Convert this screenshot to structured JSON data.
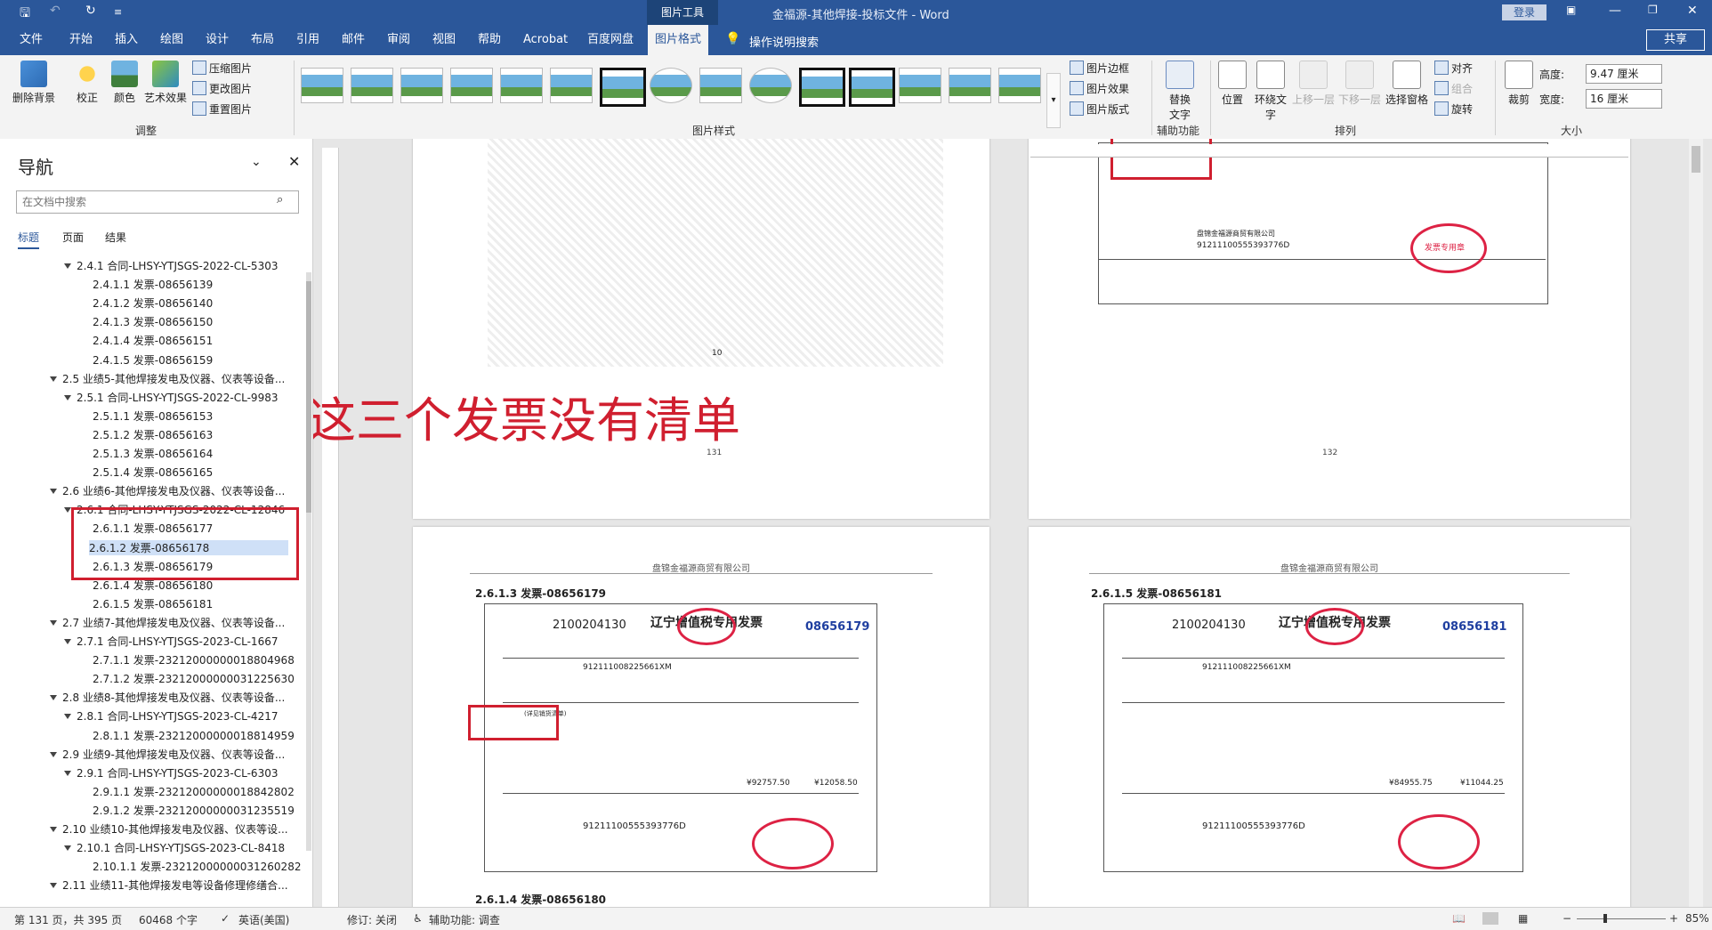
{
  "titlebar": {
    "title": "金福源-其他焊接-投标文件 - Word",
    "picture_tools": "图片工具",
    "login_button": "登录"
  },
  "menu": {
    "tabs": [
      "文件",
      "开始",
      "插入",
      "绘图",
      "设计",
      "布局",
      "引用",
      "邮件",
      "审阅",
      "视图",
      "帮助",
      "Acrobat",
      "百度网盘",
      "图片格式"
    ],
    "active_tab": "图片格式",
    "tell_me": "操作说明搜索",
    "share": "共享"
  },
  "ribbon": {
    "remove_bg": "删除背景",
    "corrections": "校正",
    "color": "颜色",
    "artistic": "艺术效果",
    "compress": "压缩图片",
    "change": "更改图片",
    "reset": "重置图片",
    "group_adjust": "调整",
    "group_styles": "图片样式",
    "border": "图片边框",
    "effects": "图片效果",
    "layout": "图片版式",
    "alt_text_1": "替换",
    "alt_text_2": "文字",
    "group_access": "辅助功能",
    "position": "位置",
    "wrap_1": "环绕文",
    "wrap_2": "字",
    "forward": "上移一层",
    "backward": "下移一层",
    "selection": "选择窗格",
    "align": "对齐",
    "group_obj": "组合",
    "rotate": "旋转",
    "group_arrange": "排列",
    "crop": "裁剪",
    "height_label": "高度:",
    "height_value": "9.47 厘米",
    "width_label": "宽度:",
    "width_value": "16 厘米",
    "group_size": "大小"
  },
  "nav": {
    "title": "导航",
    "search_placeholder": "在文档中搜索",
    "tabs": [
      "标题",
      "页面",
      "结果"
    ],
    "items": [
      {
        "level": 2,
        "text": "2.4.1 合同-LHSY-YTJSGS-2022-CL-5303",
        "arrow": true
      },
      {
        "level": 3,
        "text": "2.4.1.1 发票-08656139"
      },
      {
        "level": 3,
        "text": "2.4.1.2 发票-08656140"
      },
      {
        "level": 3,
        "text": "2.4.1.3 发票-08656150"
      },
      {
        "level": 3,
        "text": "2.4.1.4 发票-08656151"
      },
      {
        "level": 3,
        "text": "2.4.1.5 发票-08656159"
      },
      {
        "level": 1,
        "text": "2.5 业绩5-其他焊接发电及仪器、仪表等设备...",
        "arrow": true
      },
      {
        "level": 2,
        "text": "2.5.1 合同-LHSY-YTJSGS-2022-CL-9983",
        "arrow": true
      },
      {
        "level": 3,
        "text": "2.5.1.1 发票-08656153"
      },
      {
        "level": 3,
        "text": "2.5.1.2 发票-08656163"
      },
      {
        "level": 3,
        "text": "2.5.1.3 发票-08656164"
      },
      {
        "level": 3,
        "text": "2.5.1.4 发票-08656165"
      },
      {
        "level": 1,
        "text": "2.6 业绩6-其他焊接发电及仪器、仪表等设备...",
        "arrow": true
      },
      {
        "level": 2,
        "text": "2.6.1 合同-LHSY-YTJSGS-2022-CL-12846",
        "arrow": true
      },
      {
        "level": 3,
        "text": "2.6.1.1 发票-08656177"
      },
      {
        "level": 3,
        "text": "2.6.1.2 发票-08656178",
        "selected": true
      },
      {
        "level": 3,
        "text": "2.6.1.3 发票-08656179"
      },
      {
        "level": 3,
        "text": "2.6.1.4 发票-08656180"
      },
      {
        "level": 3,
        "text": "2.6.1.5 发票-08656181"
      },
      {
        "level": 1,
        "text": "2.7 业绩7-其他焊接发电及仪器、仪表等设备...",
        "arrow": true
      },
      {
        "level": 2,
        "text": "2.7.1 合同-LHSY-YTJSGS-2023-CL-1667",
        "arrow": true
      },
      {
        "level": 3,
        "text": "2.7.1.1 发票-23212000000018804968"
      },
      {
        "level": 3,
        "text": "2.7.1.2 发票-23212000000031225630"
      },
      {
        "level": 1,
        "text": "2.8 业绩8-其他焊接发电及仪器、仪表等设备...",
        "arrow": true
      },
      {
        "level": 2,
        "text": "2.8.1 合同-LHSY-YTJSGS-2023-CL-4217",
        "arrow": true
      },
      {
        "level": 3,
        "text": "2.8.1.1 发票-23212000000018814959"
      },
      {
        "level": 1,
        "text": "2.9 业绩9-其他焊接发电及仪器、仪表等设备...",
        "arrow": true
      },
      {
        "level": 2,
        "text": "2.9.1 合同-LHSY-YTJSGS-2023-CL-6303",
        "arrow": true
      },
      {
        "level": 3,
        "text": "2.9.1.1 发票-23212000000018842802"
      },
      {
        "level": 3,
        "text": "2.9.1.2 发票-23212000000031235519"
      },
      {
        "level": 1,
        "text": "2.10 业绩10-其他焊接发电及仪器、仪表等设...",
        "arrow": true
      },
      {
        "level": 2,
        "text": "2.10.1 合同-LHSY-YTJSGS-2023-CL-8418",
        "arrow": true
      },
      {
        "level": 3,
        "text": "2.10.1.1 发票-23212000000031260282"
      },
      {
        "level": 1,
        "text": "2.11 业绩11-其他焊接发电等设备修理修缮合...",
        "arrow": true
      }
    ]
  },
  "annotation": {
    "text": "这三个发票没有清单"
  },
  "pages": {
    "page_num_left": "131",
    "page_num_right": "132",
    "header_left": "盘锦金福源商贸有限公司",
    "header_right": "盘锦金福源商贸有限公司",
    "heading_left": "2.6.1.3 发票-08656179",
    "heading_right": "2.6.1.5 发票-08656181",
    "heading_bottom": "2.6.1.4 发票-08656180",
    "inv_title": "辽宁增值税专用发票",
    "inv_code": "2100204130",
    "inv_no_left": "08656179",
    "inv_no_right": "08656181",
    "inv_amount_left": "¥92757.50",
    "inv_tax_left": "¥12058.50",
    "inv_amount_right": "¥84955.75",
    "inv_tax_right": "¥11044.25",
    "seller_tax_id": "91211100555393776D",
    "seller_name": "盘锦金福源商贸有限公司",
    "buyer_tax_id": "912111008225661XM",
    "stamp_text": "发票专用章",
    "list_note": "(详见销货清单)",
    "page_mark": "10"
  },
  "status": {
    "page": "第 131 页，共 395 页",
    "words": "60468 个字",
    "lang": "英语(美国)",
    "track": "修订: 关闭",
    "access": "辅助功能: 调查",
    "zoom": "85%"
  }
}
